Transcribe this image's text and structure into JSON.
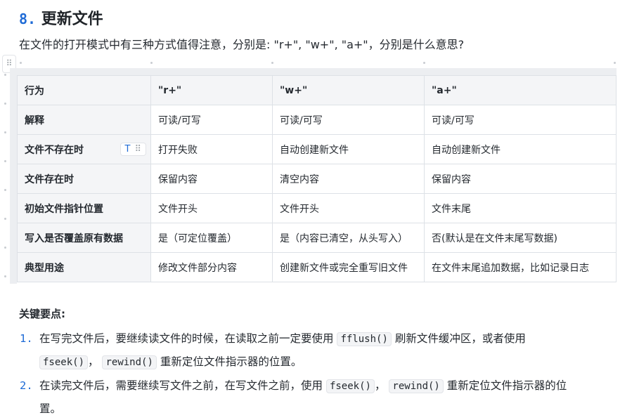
{
  "heading": {
    "number": "8.",
    "title": "更新文件"
  },
  "intro": "在文件的打开模式中有三种方式值得注意，分别是: \"r+\", \"w+\", \"a+\"，分别是什么意思?",
  "table": {
    "headers": [
      "行为",
      "\"r+\"",
      "\"w+\"",
      "\"a+\""
    ],
    "rows": [
      [
        "解释",
        "可读/可写",
        "可读/可写",
        "可读/可写"
      ],
      [
        "文件不存在时",
        "打开失败",
        "自动创建新文件",
        "自动创建新文件"
      ],
      [
        "文件存在时",
        "保留内容",
        "清空内容",
        "保留内容"
      ],
      [
        "初始文件指针位置",
        "文件开头",
        "文件开头",
        "文件末尾"
      ],
      [
        "写入是否覆盖原有数据",
        "是（可定位覆盖）",
        "是（内容已清空，从头写入）",
        "否(默认是在文件末尾写数据)"
      ],
      [
        "典型用途",
        "修改文件部分内容",
        "创建新文件或完全重写旧文件",
        "在文件末尾追加数据，比如记录日志"
      ]
    ],
    "cell_tool": {
      "text_icon": "T",
      "grip_icon": "⠿"
    }
  },
  "keypoints_title": "关键要点:",
  "list": [
    {
      "n": "1.",
      "a": "在写完文件后，要继续读文件的时候，在读取之前一定要使用",
      "c1": "fflush()",
      "b": "刷新文件缓冲区，或者使用",
      "c2": "fseek()",
      "sep": "，",
      "c3": "rewind()",
      "d": "重新定位文件指示器的位置。"
    },
    {
      "n": "2.",
      "a": "在读完文件后，需要继续写文件之前，在写文件之前，使用",
      "c1": "fseek()",
      "sep": "，",
      "c2": "rewind()",
      "b": "重新定位文件指示器的位",
      "d": "置。"
    }
  ],
  "icons": {
    "block_handle": "drag-handle-icon"
  }
}
